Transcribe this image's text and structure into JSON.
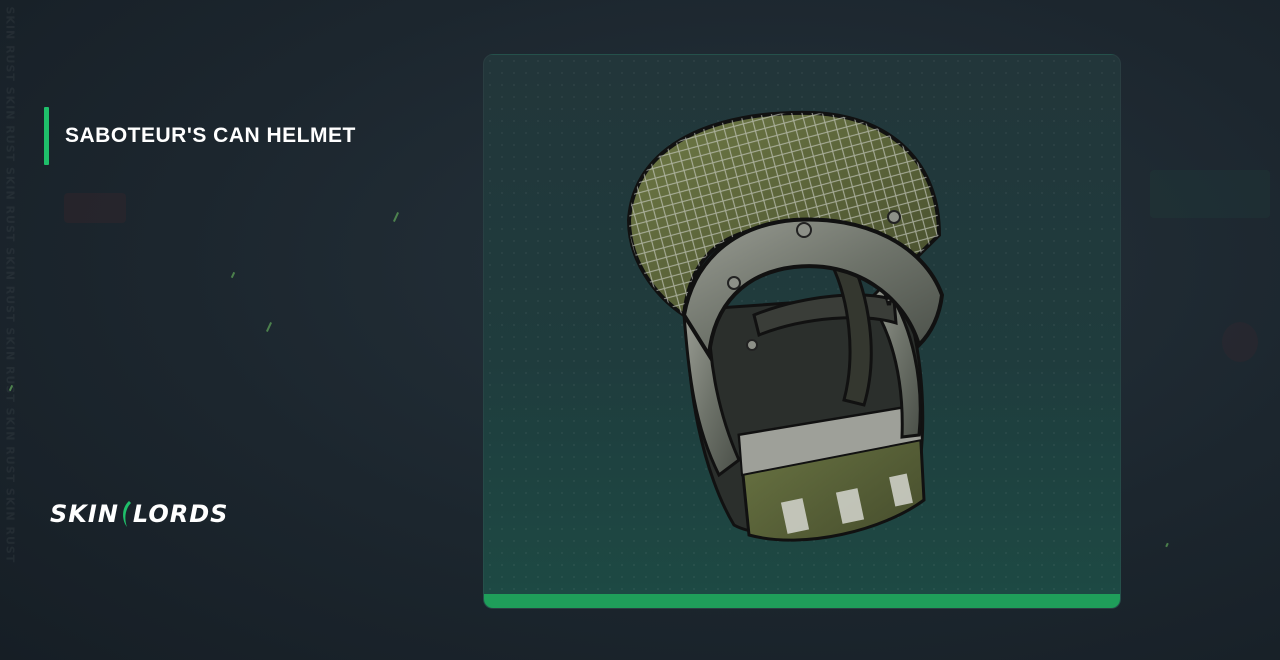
{
  "item": {
    "title": "SABOTEUR'S CAN HELMET"
  },
  "brand": {
    "logo_left": "SKIN",
    "logo_right": "LORDS"
  },
  "watermark": {
    "text": "SKIN RUST SKIN RUST SKIN RUST SKIN RUST SKIN RUST SKIN RUST SKIN RUST"
  },
  "colors": {
    "accent": "#1fbf6a",
    "card_bar": "#1f9e5a",
    "background": "#1c262e"
  },
  "icons": {
    "logo_mark": "sickle-icon"
  }
}
